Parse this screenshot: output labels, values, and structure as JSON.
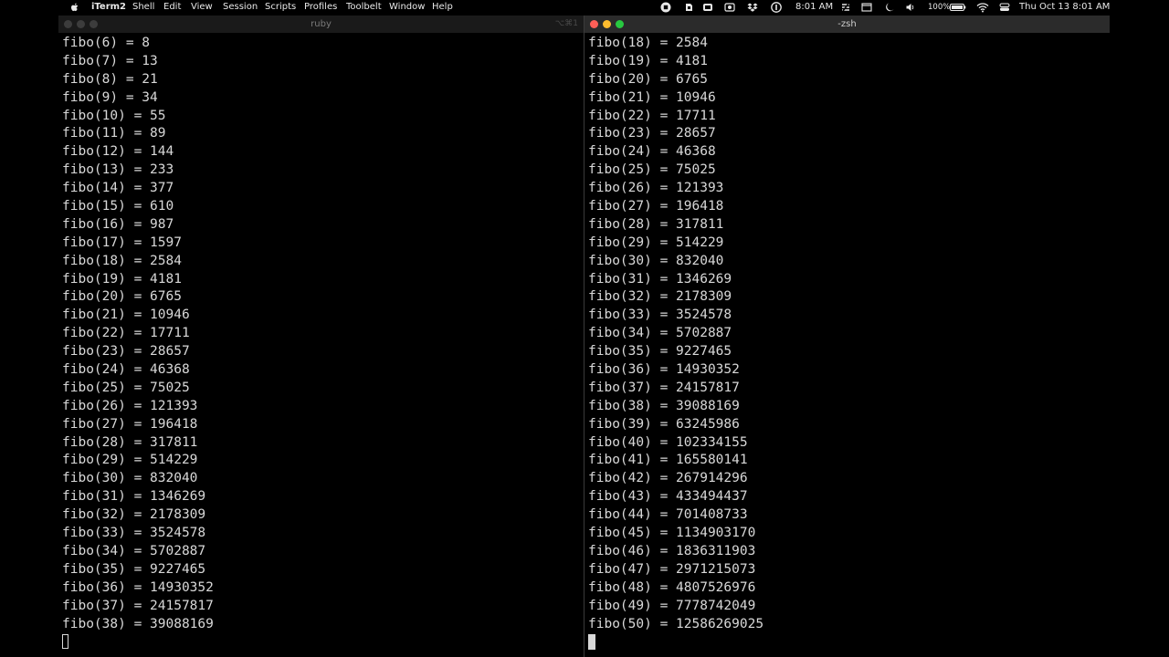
{
  "menubar": {
    "app_name": "iTerm2",
    "items": [
      "Shell",
      "Edit",
      "View",
      "Session",
      "Scripts",
      "Profiles",
      "Toolbelt",
      "Window",
      "Help"
    ],
    "time_short": "8:01 AM",
    "battery": "100%",
    "datetime": "Thu Oct 13  8:01 AM"
  },
  "left_window": {
    "title": "ruby",
    "shortcut": "⌥⌘1",
    "lines": [
      "fibo(6) = 8",
      "fibo(7) = 13",
      "fibo(8) = 21",
      "fibo(9) = 34",
      "fibo(10) = 55",
      "fibo(11) = 89",
      "fibo(12) = 144",
      "fibo(13) = 233",
      "fibo(14) = 377",
      "fibo(15) = 610",
      "fibo(16) = 987",
      "fibo(17) = 1597",
      "fibo(18) = 2584",
      "fibo(19) = 4181",
      "fibo(20) = 6765",
      "fibo(21) = 10946",
      "fibo(22) = 17711",
      "fibo(23) = 28657",
      "fibo(24) = 46368",
      "fibo(25) = 75025",
      "fibo(26) = 121393",
      "fibo(27) = 196418",
      "fibo(28) = 317811",
      "fibo(29) = 514229",
      "fibo(30) = 832040",
      "fibo(31) = 1346269",
      "fibo(32) = 2178309",
      "fibo(33) = 3524578",
      "fibo(34) = 5702887",
      "fibo(35) = 9227465",
      "fibo(36) = 14930352",
      "fibo(37) = 24157817",
      "fibo(38) = 39088169"
    ]
  },
  "right_window": {
    "title": "-zsh",
    "lines": [
      "fibo(18) = 2584",
      "fibo(19) = 4181",
      "fibo(20) = 6765",
      "fibo(21) = 10946",
      "fibo(22) = 17711",
      "fibo(23) = 28657",
      "fibo(24) = 46368",
      "fibo(25) = 75025",
      "fibo(26) = 121393",
      "fibo(27) = 196418",
      "fibo(28) = 317811",
      "fibo(29) = 514229",
      "fibo(30) = 832040",
      "fibo(31) = 1346269",
      "fibo(32) = 2178309",
      "fibo(33) = 3524578",
      "fibo(34) = 5702887",
      "fibo(35) = 9227465",
      "fibo(36) = 14930352",
      "fibo(37) = 24157817",
      "fibo(38) = 39088169",
      "fibo(39) = 63245986",
      "fibo(40) = 102334155",
      "fibo(41) = 165580141",
      "fibo(42) = 267914296",
      "fibo(43) = 433494437",
      "fibo(44) = 701408733",
      "fibo(45) = 1134903170",
      "fibo(46) = 1836311903",
      "fibo(47) = 2971215073",
      "fibo(48) = 4807526976",
      "fibo(49) = 7778742049",
      "fibo(50) = 12586269025"
    ]
  },
  "colors": {
    "terminal_bg": "#000000",
    "terminal_fg": "#d8d8d8",
    "close": "#fe5f57",
    "minimize": "#febc2e",
    "maximize": "#28c840"
  },
  "icons": [
    "apple-icon",
    "record-icon",
    "evernote-icon",
    "screen-icon",
    "camera-icon",
    "dropbox-icon",
    "onepassword-icon",
    "stripes-icon",
    "finder-window-icon",
    "moon-icon",
    "volume-icon",
    "battery-icon",
    "wifi-icon",
    "control-center-icon"
  ]
}
